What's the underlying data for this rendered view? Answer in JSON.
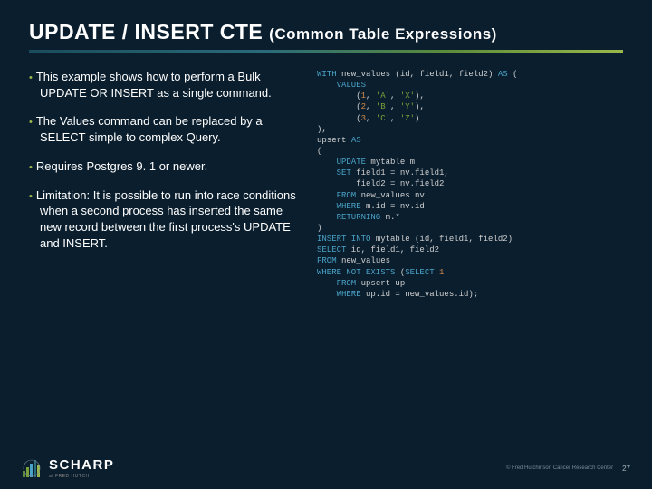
{
  "title_main": "UPDATE / INSERT CTE ",
  "title_sub": "(Common Table Expressions)",
  "bullets": [
    "This example shows how to perform a Bulk UPDATE OR INSERT as a single command.",
    "The Values command can be replaced by a SELECT simple to complex Query.",
    "Requires Postgres 9. 1 or newer.",
    "Limitation: It is possible to run into race conditions when a second process has inserted the same new record between the first process's UPDATE and INSERT."
  ],
  "code": {
    "l1_with": "WITH",
    "l1_nv": " new_values ",
    "l1_cols": "(id, field1, field2)",
    "l1_as": " AS ",
    "l1_paren": "(",
    "l2_values": "    VALUES",
    "l3a": "        (",
    "l3n": "1",
    "l3c": ", ",
    "l3s1": "'A'",
    "l3s2": "'X'",
    "l3e": "),",
    "l4n": "2",
    "l4s1": "'B'",
    "l4s2": "'Y'",
    "l5n": "3",
    "l5s1": "'C'",
    "l5s2": "'Z'",
    "l5e": ")",
    "l6": "),",
    "l7_up": "upsert ",
    "l7_as": "AS",
    "l8": "(",
    "l9_upd": "    UPDATE",
    "l9_t": " mytable m",
    "l10_set": "    SET",
    "l10_r": " field1 = nv.field1,",
    "l11": "        field2 = nv.field2",
    "l12_from": "    FROM",
    "l12_r": " new_values nv",
    "l13_where": "    WHERE",
    "l13_r": " m.id = nv.id",
    "l14_ret": "    RETURNING",
    "l14_r": " m.",
    "l14_star": "*",
    "l15": ")",
    "l16_ins": "INSERT INTO",
    "l16_t": " mytable ",
    "l16_cols": "(id, field1, field2)",
    "l17_sel": "SELECT",
    "l17_r": " id, field1, field2",
    "l18_from": "FROM",
    "l18_r": " new_values",
    "l19_wne": "WHERE NOT EXISTS",
    "l19_p": " (",
    "l19_sel": "SELECT ",
    "l19_1": "1",
    "l20_from": "    FROM",
    "l20_r": " upsert up",
    "l21_where": "    WHERE",
    "l21_r": " up.id = new_values.id);"
  },
  "logo_text": "SCHARP",
  "logo_sub": "at FRED HUTCH",
  "copyright": "© Fred Hutchinson Cancer Research Center",
  "page_number": "27"
}
